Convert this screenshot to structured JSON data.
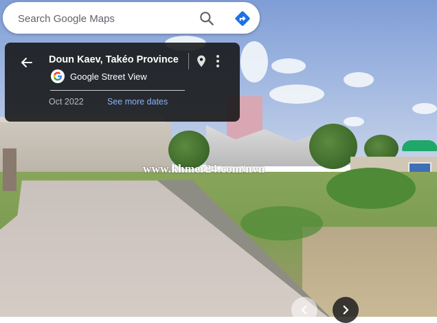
{
  "search": {
    "placeholder": "Search Google Maps"
  },
  "icons": {
    "search": "search-icon",
    "directions": "directions-icon",
    "back": "arrow-left-icon",
    "pin": "map-pin-icon",
    "more": "more-vertical-icon",
    "google_logo": "google-g-icon",
    "nav_prev": "chevron-left-icon",
    "nav_next": "chevron-right-icon"
  },
  "panel": {
    "title": "Doun Kaev, Takéo Province",
    "source": "Google Street View",
    "date": "Oct 2022",
    "more_dates": "See more dates"
  },
  "overlay": {
    "watermark": "www.khmer24.com/nvn"
  },
  "colors": {
    "directions": "#1a73e8",
    "link": "#8ab4f8",
    "panel_bg": "#141414"
  }
}
